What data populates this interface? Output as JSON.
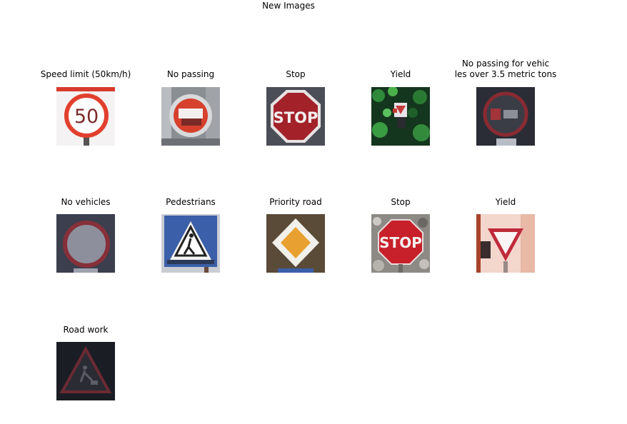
{
  "figure": {
    "title": "New Images"
  },
  "images": [
    {
      "caption": "Speed limit (50km/h)",
      "sign_text": "50",
      "icon": "speed-limit-sign"
    },
    {
      "caption": "No passing",
      "icon": "no-passing-sign"
    },
    {
      "caption": "Stop",
      "sign_text": "STOP",
      "icon": "stop-sign"
    },
    {
      "caption": "Yield",
      "icon": "yield-sign"
    },
    {
      "caption": "No passing for vehic\nles over 3.5 metric tons",
      "icon": "no-passing-trucks-sign"
    },
    {
      "caption": "No vehicles",
      "icon": "no-vehicles-sign"
    },
    {
      "caption": "Pedestrians",
      "icon": "pedestrians-sign"
    },
    {
      "caption": "Priority road",
      "icon": "priority-road-sign"
    },
    {
      "caption": "Stop",
      "sign_text": "STOP",
      "icon": "stop-sign"
    },
    {
      "caption": "Yield",
      "icon": "yield-sign"
    },
    {
      "caption": "Road work",
      "icon": "road-work-sign"
    }
  ],
  "colors": {
    "sign_red": "#c8202a",
    "sign_blue": "#3b5fa8",
    "priority_yellow": "#e8a030"
  }
}
